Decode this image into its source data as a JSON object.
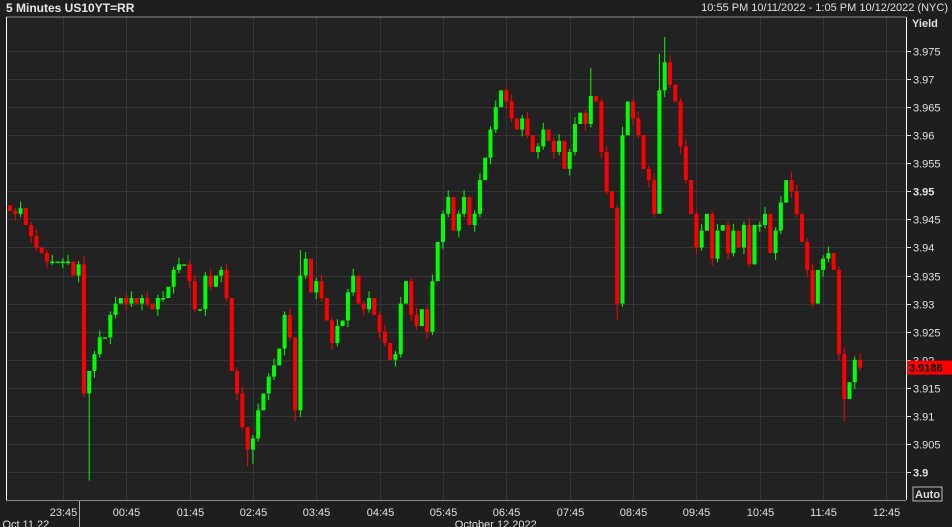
{
  "header": {
    "title": "5 Minutes US10YT=RR",
    "range": "10:55 PM 10/11/2022 - 1:05 PM 10/12/2022 (NYC)"
  },
  "axis": {
    "y_title": "Yield",
    "auto_label": "Auto"
  },
  "last_price": {
    "label": "3.9186",
    "value": 3.9186
  },
  "colors": {
    "up": "#00ff00",
    "down": "#ff0000",
    "plot_bg": "#222222",
    "grid": "#363636",
    "badge": "#ff0000"
  },
  "chart_data": {
    "type": "candlestick",
    "title": "5 Minutes US10YT=RR",
    "ylabel": "Yield",
    "ylim": [
      3.897,
      3.983
    ],
    "yticks": [
      3.9,
      3.905,
      3.91,
      3.915,
      3.92,
      3.925,
      3.93,
      3.935,
      3.94,
      3.945,
      3.95,
      3.955,
      3.96,
      3.965,
      3.97,
      3.975
    ],
    "ytick_labels": [
      "3.9",
      "3.905",
      "3.91",
      "3.915",
      "3.92",
      "3.925",
      "3.93",
      "3.935",
      "3.94",
      "3.945",
      "3.95",
      "3.955",
      "3.96",
      "3.965",
      "3.97",
      "3.975"
    ],
    "bold_ticks": [
      "3.9",
      "3.95"
    ],
    "interval_minutes": 5,
    "start_time": "22:55",
    "end_time": "13:05",
    "xtick_labels": [
      "23:45",
      "00:45",
      "01:45",
      "02:45",
      "03:45",
      "04:45",
      "05:45",
      "06:45",
      "07:45",
      "08:45",
      "09:45",
      "10:45",
      "11:45",
      "12:45"
    ],
    "xtick_index": [
      10,
      22,
      34,
      46,
      58,
      70,
      82,
      94,
      106,
      118,
      130,
      142,
      154,
      166
    ],
    "date_labels": [
      {
        "text": "Oct 11 22",
        "index": 3
      },
      {
        "text": "October 12 2022",
        "index": 92
      }
    ],
    "day_break_index": 13,
    "total_slots": 170,
    "open_first": 3.9475,
    "close": [
      3.9465,
      3.946,
      3.947,
      3.944,
      3.942,
      3.94,
      3.939,
      3.9375,
      3.9375,
      3.9375,
      3.9375,
      3.9375,
      3.935,
      3.937,
      3.914,
      3.918,
      3.921,
      3.924,
      3.924,
      3.928,
      3.93,
      3.931,
      3.93,
      3.931,
      3.93,
      3.931,
      3.93,
      3.929,
      3.931,
      3.931,
      3.933,
      3.936,
      3.937,
      3.937,
      3.934,
      3.929,
      3.929,
      3.935,
      3.933,
      3.935,
      3.936,
      3.931,
      3.918,
      3.914,
      3.908,
      3.904,
      3.906,
      3.911,
      3.914,
      3.917,
      3.919,
      3.922,
      3.928,
      3.924,
      3.911,
      3.935,
      3.938,
      3.932,
      3.934,
      3.931,
      3.927,
      3.923,
      3.926,
      3.927,
      3.932,
      3.935,
      3.93,
      3.929,
      3.931,
      3.928,
      3.925,
      3.923,
      3.92,
      3.921,
      3.93,
      3.934,
      3.928,
      3.926,
      3.929,
      3.925,
      3.934,
      3.941,
      3.946,
      3.949,
      3.943,
      3.946,
      3.949,
      3.944,
      3.946,
      3.952,
      3.956,
      3.961,
      3.965,
      3.968,
      3.966,
      3.963,
      3.961,
      3.963,
      3.96,
      3.957,
      3.958,
      3.961,
      3.959,
      3.957,
      3.959,
      3.954,
      3.957,
      3.962,
      3.964,
      3.962,
      3.967,
      3.966,
      3.957,
      3.95,
      3.947,
      3.93,
      3.96,
      3.966,
      3.963,
      3.96,
      3.954,
      3.952,
      3.946,
      3.968,
      3.973,
      3.969,
      3.966,
      3.958,
      3.952,
      3.946,
      3.94,
      3.943,
      3.946,
      3.938,
      3.943,
      3.944,
      3.939,
      3.943,
      3.94,
      3.944,
      3.937,
      3.944,
      3.944,
      3.946,
      3.939,
      3.943,
      3.948,
      3.952,
      3.95,
      3.946,
      3.941,
      3.936,
      3.93,
      3.936,
      3.938,
      3.939,
      3.936,
      3.921,
      3.913,
      3.916,
      3.92,
      3.9186
    ],
    "wick": 0.0012,
    "high_overrides": {
      "14": 3.9385,
      "42": 3.931,
      "55": 3.9395,
      "110": 3.972,
      "116": 3.9615,
      "124": 3.9775,
      "123": 3.9745,
      "148": 3.9535
    },
    "low_overrides": {
      "15": 3.8985,
      "45": 3.901,
      "46": 3.9015,
      "54": 3.909,
      "115": 3.927,
      "158": 3.909
    }
  }
}
